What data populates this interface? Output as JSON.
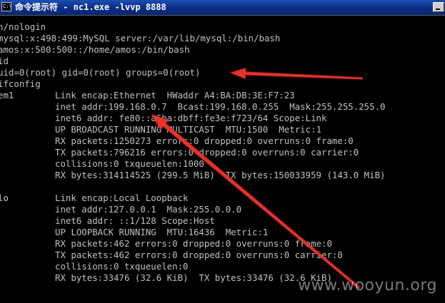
{
  "window": {
    "title": "命令提示符 - nc1.exe -lvvp 8888",
    "icon_text": "C:\\"
  },
  "terminal": {
    "lines": [
      {
        "c1": "n/nologin",
        "c2": ""
      },
      {
        "c1": "mysql:x:498:499:MySQL server:/var/lib/mysql:/bin/bash",
        "c2": ""
      },
      {
        "c1": "amos:x:500:500::/home/amos:/bin/bash",
        "c2": ""
      },
      {
        "c1": "id",
        "c2": ""
      },
      {
        "c1": "uid=0(root) gid=0(root) groups=0(root)",
        "c2": ""
      },
      {
        "c1": "ifconfig",
        "c2": ""
      },
      {
        "c1": "em1",
        "c2": "Link encap:Ethernet  HWaddr A4:BA:DB:3E:F7:23"
      },
      {
        "c1": "",
        "c2": "inet addr:199.168.0.7  Bcast:199.168.0.255  Mask:255.255.255.0"
      },
      {
        "c1": "",
        "c2": "inet6 addr: fe80::a6ba:dbff:fe3e:f723/64 Scope:Link"
      },
      {
        "c1": "",
        "c2": "UP BROADCAST RUNNING MULTICAST  MTU:1500  Metric:1"
      },
      {
        "c1": "",
        "c2": "RX packets:1250273 errors:0 dropped:0 overruns:0 frame:0"
      },
      {
        "c1": "",
        "c2": "TX packets:796216 errors:0 dropped:0 overruns:0 carrier:0"
      },
      {
        "c1": "",
        "c2": "collisions:0 txqueuelen:1000"
      },
      {
        "c1": "",
        "c2": "RX bytes:314114525 (299.5 MiB)  TX bytes:150033959 (143.0 MiB)"
      },
      {
        "c1": "",
        "c2": ""
      },
      {
        "c1": "lo",
        "c2": "Link encap:Local Loopback"
      },
      {
        "c1": "",
        "c2": "inet addr:127.0.0.1  Mask:255.0.0.0"
      },
      {
        "c1": "",
        "c2": "inet6 addr: ::1/128 Scope:Host"
      },
      {
        "c1": "",
        "c2": "UP LOOPBACK RUNNING  MTU:16436  Metric:1"
      },
      {
        "c1": "",
        "c2": "RX packets:462 errors:0 dropped:0 overruns:0 frame:0"
      },
      {
        "c1": "",
        "c2": "TX packets:462 errors:0 dropped:0 overruns:0 carrier:0"
      },
      {
        "c1": "",
        "c2": "collisions:0 txqueuelen:0"
      },
      {
        "c1": "",
        "c2": "RX bytes:33476 (32.6 KiB)  TX bytes:33476 (32.6 KiB)"
      }
    ]
  },
  "annotations": {
    "arrow_color": "#e8332a"
  },
  "watermark": {
    "text": "www.wooyun.org"
  }
}
